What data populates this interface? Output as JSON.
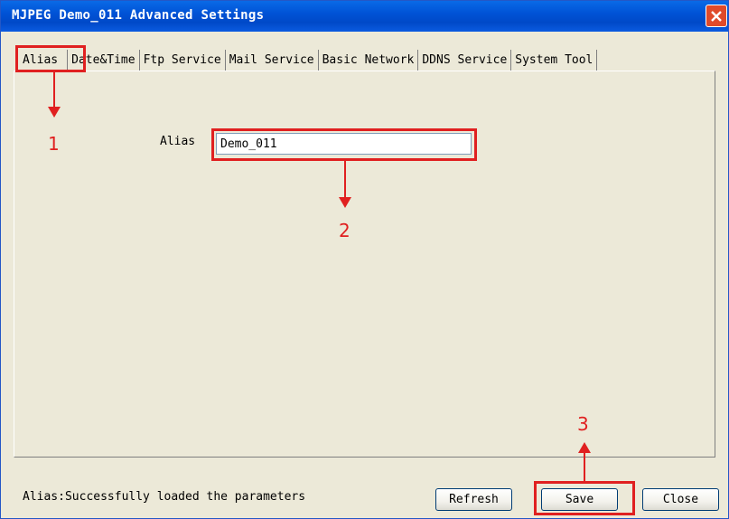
{
  "window": {
    "title": "MJPEG Demo_011 Advanced Settings",
    "close_icon": "close-icon"
  },
  "tabs": [
    {
      "label": "Alias",
      "active": true
    },
    {
      "label": "Date&Time",
      "active": false
    },
    {
      "label": "Ftp Service",
      "active": false
    },
    {
      "label": "Mail Service",
      "active": false
    },
    {
      "label": "Basic Network",
      "active": false
    },
    {
      "label": "DDNS Service",
      "active": false
    },
    {
      "label": "System Tool",
      "active": false
    }
  ],
  "alias_form": {
    "label": "Alias",
    "value": "Demo_011"
  },
  "annotations": {
    "step1": "1",
    "step2": "2",
    "step3": "3",
    "color": "#e02020"
  },
  "status_bar": {
    "message": "Alias:Successfully loaded the parameters"
  },
  "buttons": {
    "refresh": "Refresh",
    "save": "Save",
    "close": "Close"
  },
  "colors": {
    "titlebar": "#0053d6",
    "dialog_bg": "#ece9d8",
    "highlight": "#e02020"
  }
}
